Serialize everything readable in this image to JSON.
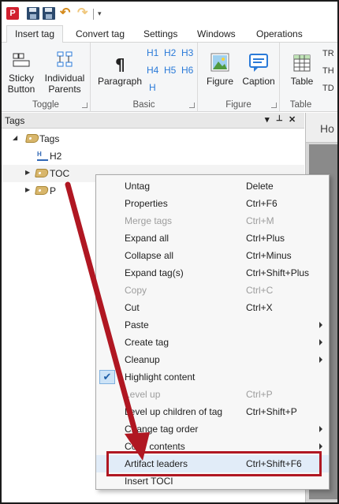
{
  "qat": {
    "logo": "P",
    "more": "▾"
  },
  "tabs": [
    {
      "label": "Insert tag"
    },
    {
      "label": "Convert tag"
    },
    {
      "label": "Settings"
    },
    {
      "label": "Windows"
    },
    {
      "label": "Operations"
    }
  ],
  "ribbon": {
    "toggle": {
      "sticky_button": "Sticky Button",
      "individual_parents": "Individual Parents",
      "label": "Toggle"
    },
    "basic": {
      "paragraph": "Paragraph",
      "h1": "H1",
      "h2": "H2",
      "h3": "H3",
      "h4": "H4",
      "h5": "H5",
      "h6": "H6",
      "h": "H",
      "label": "Basic"
    },
    "figure": {
      "figure": "Figure",
      "caption": "Caption",
      "label": "Figure"
    },
    "table": {
      "table": "Table",
      "tr": "TR",
      "th": "TH",
      "td": "TD",
      "label": "Table"
    }
  },
  "panel": {
    "title": "Tags",
    "controls": {
      "dropdown": "▾",
      "pin": "ꟷ",
      "close": "✕"
    }
  },
  "tree": {
    "root": "Tags",
    "items": [
      {
        "label": "H2"
      },
      {
        "label": "TOC"
      },
      {
        "label": "P"
      }
    ]
  },
  "doc": {
    "tab_label": "Ho"
  },
  "context_menu": {
    "items": [
      {
        "label": "Untag",
        "shortcut": "Delete",
        "enabled": true,
        "submenu": false
      },
      {
        "label": "Properties",
        "shortcut": "Ctrl+F6",
        "enabled": true,
        "submenu": false
      },
      {
        "label": "Merge tags",
        "shortcut": "Ctrl+M",
        "enabled": false,
        "submenu": false
      },
      {
        "label": "Expand all",
        "shortcut": "Ctrl+Plus",
        "enabled": true,
        "submenu": false
      },
      {
        "label": "Collapse all",
        "shortcut": "Ctrl+Minus",
        "enabled": true,
        "submenu": false
      },
      {
        "label": "Expand tag(s)",
        "shortcut": "Ctrl+Shift+Plus",
        "enabled": true,
        "submenu": false
      },
      {
        "label": "Copy",
        "shortcut": "Ctrl+C",
        "enabled": false,
        "submenu": false
      },
      {
        "label": "Cut",
        "shortcut": "Ctrl+X",
        "enabled": true,
        "submenu": false
      },
      {
        "label": "Paste",
        "shortcut": "",
        "enabled": true,
        "submenu": true
      },
      {
        "label": "Create tag",
        "shortcut": "",
        "enabled": true,
        "submenu": true
      },
      {
        "label": "Cleanup",
        "shortcut": "",
        "enabled": true,
        "submenu": true
      },
      {
        "label": "Highlight content",
        "shortcut": "",
        "enabled": true,
        "submenu": false,
        "checked": true
      },
      {
        "label": "Level up",
        "shortcut": "Ctrl+P",
        "enabled": false,
        "submenu": false
      },
      {
        "label": "Level up children of tag",
        "shortcut": "Ctrl+Shift+P",
        "enabled": true,
        "submenu": false
      },
      {
        "label": "Change tag order",
        "shortcut": "",
        "enabled": true,
        "submenu": true
      },
      {
        "label": "Copy contents",
        "shortcut": "",
        "enabled": true,
        "submenu": true
      },
      {
        "label": "Artifact leaders",
        "shortcut": "Ctrl+Shift+F6",
        "enabled": true,
        "submenu": false,
        "highlighted": true
      },
      {
        "label": "Insert TOCI",
        "shortcut": "",
        "enabled": true,
        "submenu": false
      }
    ],
    "check_mark": "✔"
  },
  "colors": {
    "annotation": "#b01722",
    "accent": "#2a7ad8"
  }
}
